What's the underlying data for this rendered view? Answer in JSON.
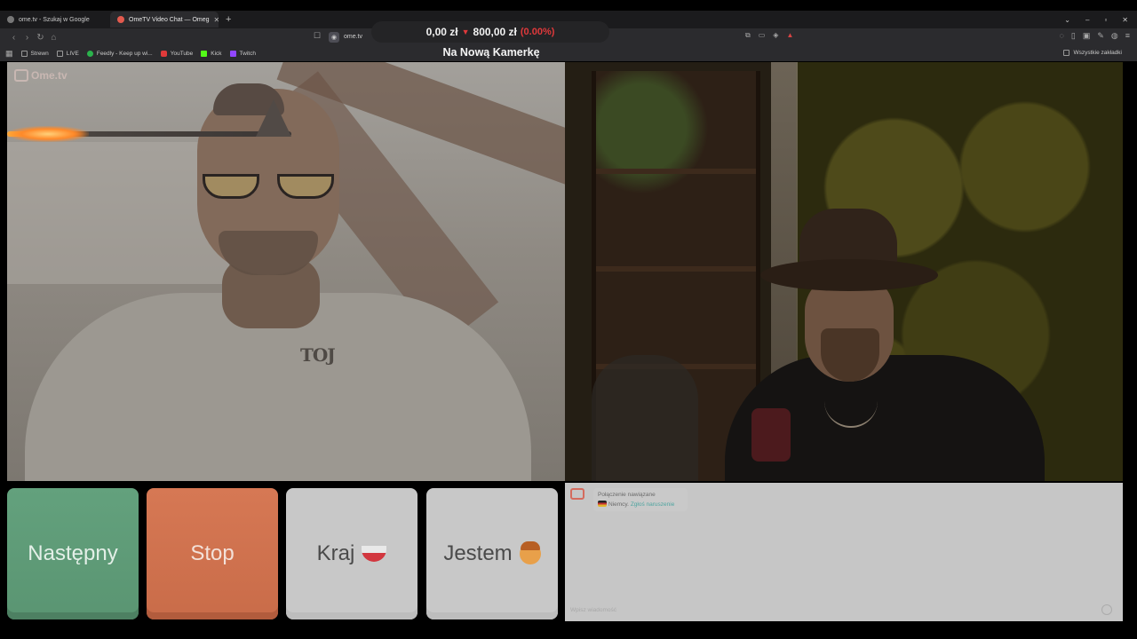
{
  "browser": {
    "tabs": [
      {
        "label": "ome.tv - Szukaj w Google",
        "active": false
      },
      {
        "label": "OmeTV Video Chat — Omeg",
        "active": true
      }
    ],
    "new_tab": "+",
    "url": "ome.tv",
    "ticker": {
      "value1": "0,00 zł",
      "value2": "800,00 zł",
      "change": "(0.00%)"
    },
    "bookmarks": [
      {
        "label": "Strewn",
        "icon": "folder-icon"
      },
      {
        "label": "LIVE",
        "icon": "folder-icon"
      },
      {
        "label": "Feedly - Keep up wi...",
        "icon": "feedly-icon"
      },
      {
        "label": "YouTube",
        "icon": "youtube-icon"
      },
      {
        "label": "Kick",
        "icon": "kick-icon"
      },
      {
        "label": "Twitch",
        "icon": "twitch-icon"
      }
    ],
    "all_bookmarks": "Wszystkie zakładki"
  },
  "overlay": {
    "title": "Na Nową Kamerkę"
  },
  "video": {
    "watermark": "Ome.tv",
    "shirt_text": "TOJ"
  },
  "controls": {
    "next": "Następny",
    "stop": "Stop",
    "country": "Kraj",
    "gender": "Jestem"
  },
  "chat": {
    "status": "Połączenie nawiązane",
    "country_name": "Niemcy.",
    "report_link": "Zgłoś naruszenie",
    "input_placeholder": "Wpisz wiadomość"
  },
  "colors": {
    "next": "#63a17d",
    "stop": "#d67854",
    "ticker_negative": "#e0393b"
  }
}
